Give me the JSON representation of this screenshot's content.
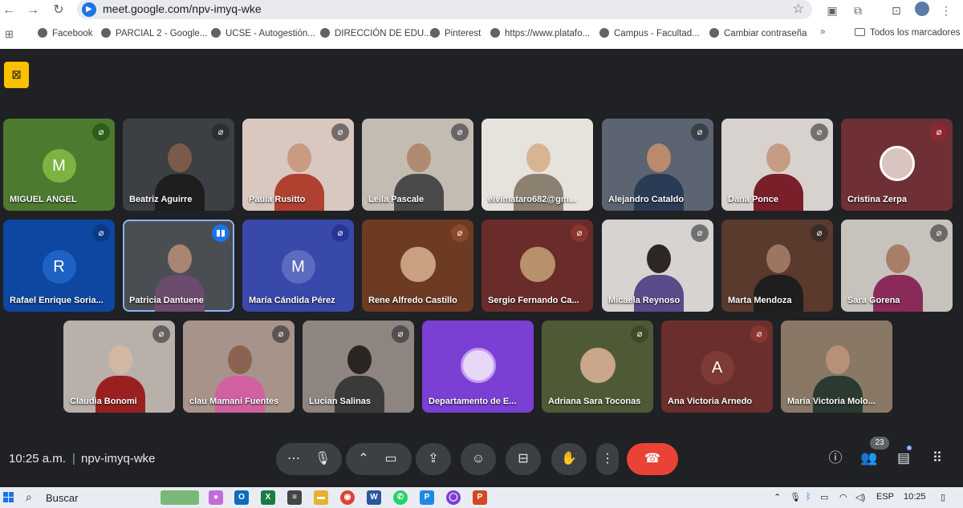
{
  "browser": {
    "url": "meet.google.com/npv-imyq-wke",
    "bookmarks": [
      "Facebook",
      "PARCIAL 2 - Google...",
      "UCSE - Autogestión...",
      "DIRECCIÓN DE EDU...",
      "Pinterest",
      "https://www.platafo...",
      "Campus - Facultad...",
      "Cambiar contraseña"
    ],
    "overflow": "»",
    "all_bookmarks": "Todos los marcadores"
  },
  "participants": [
    {
      "name": "MIGUEL ANGEL",
      "initial": "M"
    },
    {
      "name": "Beatriz Aguirre"
    },
    {
      "name": "Paula Rusitto"
    },
    {
      "name": "Leila Pascale"
    },
    {
      "name": "elvimataro682@gm..."
    },
    {
      "name": "Alejandro Cataldo"
    },
    {
      "name": "Dana Ponce"
    },
    {
      "name": "Cristina Zerpa"
    },
    {
      "name": "Rafael Enrique Soria...",
      "initial": "R"
    },
    {
      "name": "Patricia Dantuene"
    },
    {
      "name": "María Cándida Pérez",
      "initial": "M"
    },
    {
      "name": "Rene Alfredo Castillo"
    },
    {
      "name": "Sergio Fernando Ca..."
    },
    {
      "name": "Micaela Reynoso"
    },
    {
      "name": "Marta Mendoza"
    },
    {
      "name": "Sara Gorena"
    },
    {
      "name": "Claudia Bonomi"
    },
    {
      "name": "clau Mamani Fuentes"
    },
    {
      "name": "Lucian Salinas"
    },
    {
      "name": "Departamento de E..."
    },
    {
      "name": "Adriana Sara Toconas"
    },
    {
      "name": "Ana Victoria Arnedo",
      "initial": "A"
    },
    {
      "name": "María Victoria Molo..."
    }
  ],
  "meeting": {
    "time": "10:25 a.m.",
    "separator": "|",
    "code": "npv-imyq-wke",
    "people_count": "23"
  },
  "taskbar": {
    "search_placeholder": "Buscar",
    "language": "ESP",
    "time": "10:25"
  },
  "colors": {
    "meet_bg": "#202124",
    "end_call": "#ea4335",
    "speaking": "#1a73e8"
  }
}
